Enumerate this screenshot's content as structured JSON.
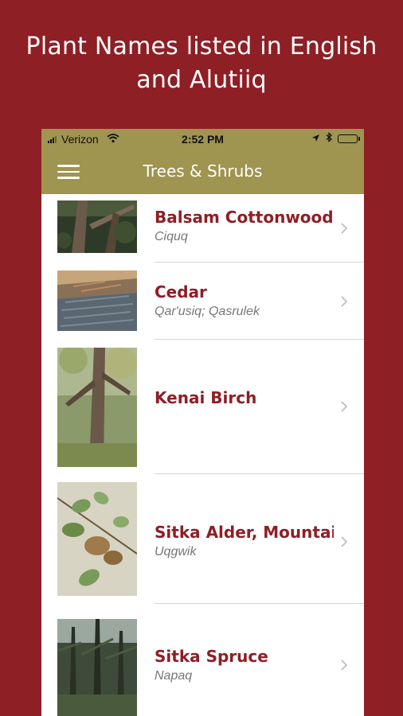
{
  "promo": {
    "line1": "Plant Names listed in English",
    "line2": "and Alutiiq"
  },
  "status_bar": {
    "carrier": "Verizon",
    "time": "2:52 PM",
    "icons": [
      "signal-icon",
      "wifi-icon",
      "location-icon",
      "bluetooth-icon",
      "battery-icon"
    ]
  },
  "nav": {
    "title": "Trees & Shrubs",
    "menu_icon": "hamburger-menu-icon"
  },
  "colors": {
    "background": "#8e1f25",
    "navbar": "#9f9450",
    "title_text": "#8e1f25",
    "subtitle_text": "#777777",
    "battery": "#4cd964"
  },
  "items": [
    {
      "title": "Balsam Cottonwood,",
      "subtitle": "Ciquq"
    },
    {
      "title": "Cedar",
      "subtitle": "Qar'usiq; Qasrulek"
    },
    {
      "title": "Kenai Birch",
      "subtitle": ""
    },
    {
      "title": "Sitka Alder, Mountain",
      "subtitle": "Uqgwik"
    },
    {
      "title": "Sitka Spruce",
      "subtitle": "Napaq"
    }
  ]
}
